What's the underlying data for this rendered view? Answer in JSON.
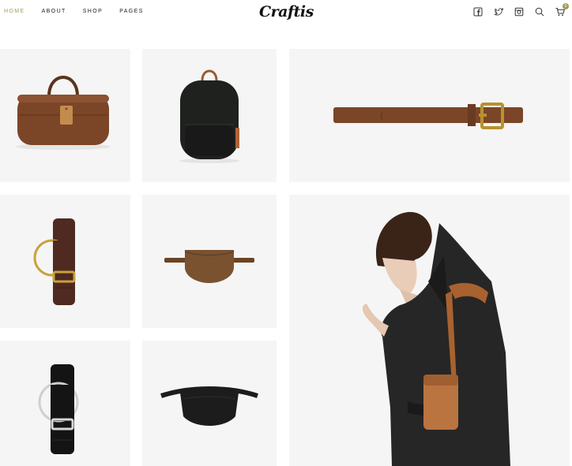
{
  "nav": {
    "items": [
      {
        "label": "HOME",
        "active": true
      },
      {
        "label": "ABOUT",
        "active": false
      },
      {
        "label": "SHOP",
        "active": false
      },
      {
        "label": "PAGES",
        "active": false
      }
    ]
  },
  "logo": {
    "text": "Craftis"
  },
  "header_icons": [
    "facebook-icon",
    "twitter-icon",
    "instagram-icon",
    "search-icon",
    "cart-icon"
  ],
  "cart": {
    "count": "0"
  },
  "colors": {
    "accent": "#a39a5c",
    "tile_bg": "#f5f5f5",
    "leather_brown": "#7b4528",
    "black": "#1c1c1c"
  },
  "products": [
    {
      "name": "leather-duffel-bag"
    },
    {
      "name": "black-backpack"
    },
    {
      "name": "brown-leather-belt"
    },
    {
      "name": "brown-strap-watch"
    },
    {
      "name": "suede-belt-bag"
    },
    {
      "name": "model-with-shoulder-bag"
    },
    {
      "name": "black-strap-watch"
    },
    {
      "name": "black-belt-bag"
    }
  ]
}
